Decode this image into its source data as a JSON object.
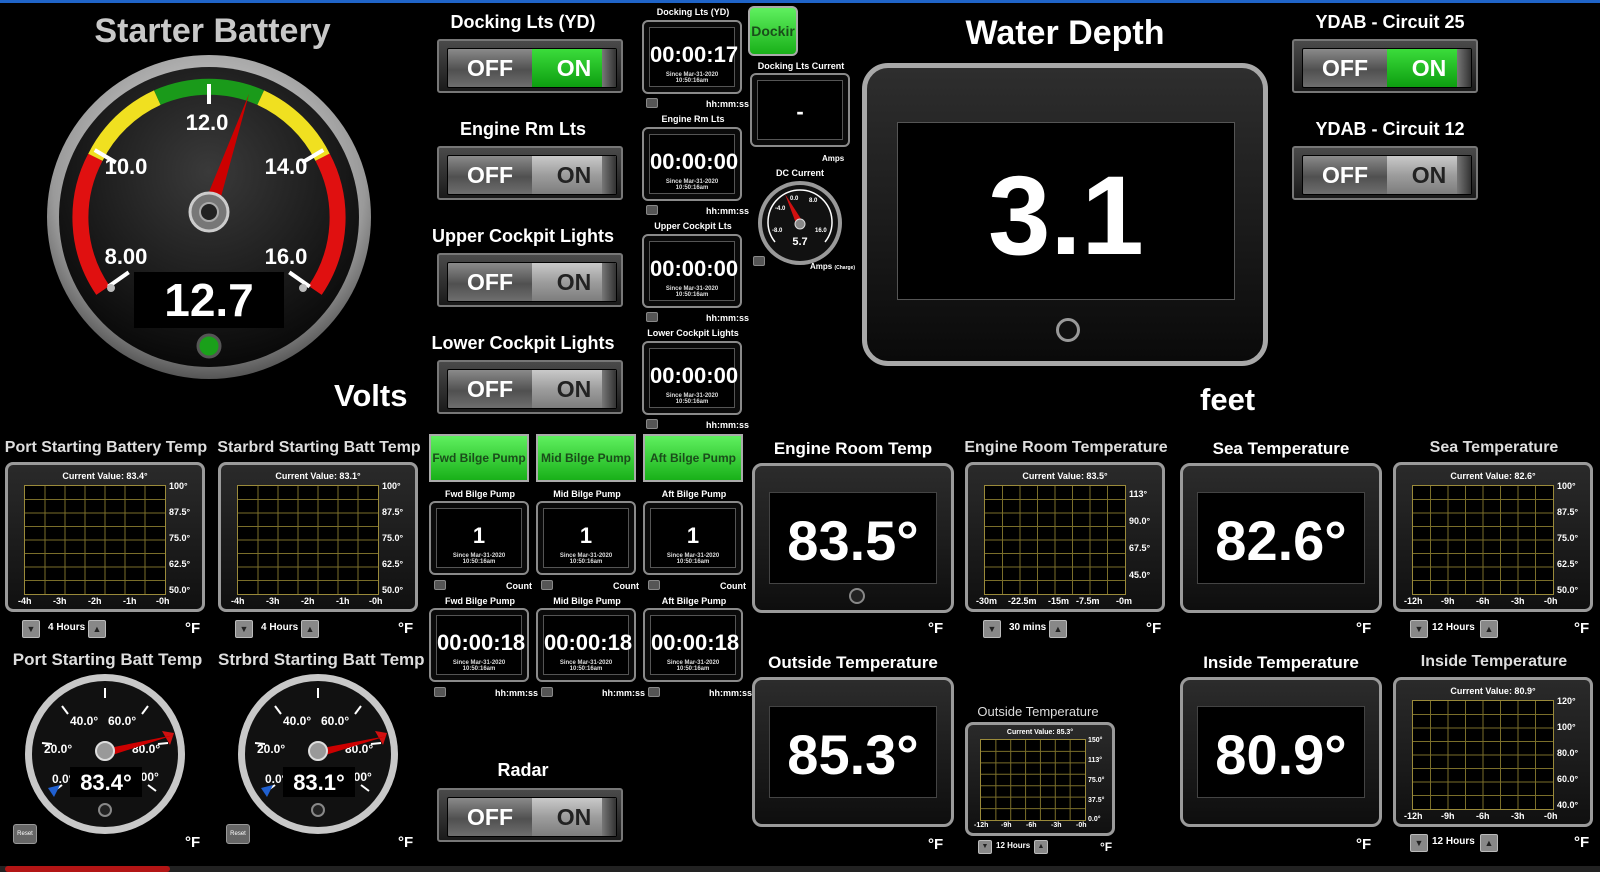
{
  "starter_battery": {
    "title": "Starter Battery",
    "value": "12.7",
    "unit": "Volts",
    "ticks": [
      "8.00",
      "10.0",
      "12.0",
      "14.0",
      "16.0"
    ]
  },
  "switches": [
    {
      "title": "Docking Lts (YD)",
      "off": "OFF",
      "on": "ON",
      "state": "on"
    },
    {
      "title": "Engine Rm Lts",
      "off": "OFF",
      "on": "ON",
      "state": "off"
    },
    {
      "title": "Upper Cockpit Lights",
      "off": "OFF",
      "on": "ON",
      "state": "off"
    },
    {
      "title": "Lower Cockpit Lights",
      "off": "OFF",
      "on": "ON",
      "state": "off"
    },
    {
      "title": "Radar",
      "off": "OFF",
      "on": "ON",
      "state": "off"
    },
    {
      "title": "YDAB - Circuit 25",
      "off": "OFF",
      "on": "ON",
      "state": "on"
    },
    {
      "title": "YDAB - Circuit 12",
      "off": "OFF",
      "on": "ON",
      "state": "off"
    }
  ],
  "timers": [
    {
      "label": "Docking Lts (YD)",
      "value": "00:00:17",
      "since": "Since Mar-31-2020 10:50:16am",
      "unit": "hh:mm:ss"
    },
    {
      "label": "Engine Rm Lts",
      "value": "00:00:00",
      "since": "Since Mar-31-2020 10:50:16am",
      "unit": "hh:mm:ss"
    },
    {
      "label": "Upper Cockpit Lts",
      "value": "00:00:00",
      "since": "Since Mar-31-2020 10:50:16am",
      "unit": "hh:mm:ss"
    },
    {
      "label": "Lower Cockpit Lights",
      "value": "00:00:00",
      "since": "Since Mar-31-2020 10:50:16am",
      "unit": "hh:mm:ss"
    }
  ],
  "docking_button": "Dockir",
  "docking_current": {
    "label": "Docking Lts Current",
    "value": "-",
    "unit": "Amps"
  },
  "dc_current": {
    "label": "DC Current",
    "value": "5.7",
    "unit": "Amps",
    "sub": "(Charge)",
    "ticks": [
      "-8.0",
      "-4.0",
      "0.0",
      "8.0",
      "16.0"
    ]
  },
  "water_depth": {
    "title": "Water Depth",
    "value": "3.1",
    "unit": "feet"
  },
  "bilge": {
    "buttons": [
      "Fwd Bilge Pump",
      "Mid Bilge Pump",
      "Aft Bilge Pump"
    ],
    "counts": [
      {
        "label": "Fwd Bilge Pump",
        "value": "1",
        "since": "Since Mar-31-2020 10:50:16am",
        "unit": "Count"
      },
      {
        "label": "Mid Bilge Pump",
        "value": "1",
        "since": "Since Mar-31-2020 10:50:16am",
        "unit": "Count"
      },
      {
        "label": "Aft Bilge Pump",
        "value": "1",
        "since": "Since Mar-31-2020 10:50:16am",
        "unit": "Count"
      }
    ],
    "runtimes": [
      {
        "label": "Fwd Bilge Pump",
        "value": "00:00:18",
        "since": "Since Mar-31-2020 10:50:16am",
        "unit": "hh:mm:ss"
      },
      {
        "label": "Mid Bilge Pump",
        "value": "00:00:18",
        "since": "Since Mar-31-2020 10:50:16am",
        "unit": "hh:mm:ss"
      },
      {
        "label": "Aft Bilge Pump",
        "value": "00:00:18",
        "since": "Since Mar-31-2020 10:50:16am",
        "unit": "hh:mm:ss"
      }
    ]
  },
  "value_boxes": [
    {
      "title": "Engine Room Temp",
      "value": "83.5°",
      "unit": "°F"
    },
    {
      "title": "Sea Temperature",
      "value": "82.6°",
      "unit": "°F"
    },
    {
      "title": "Outside Temperature",
      "value": "85.3°",
      "unit": "°F"
    },
    {
      "title": "Inside Temperature",
      "value": "80.9°",
      "unit": "°F"
    }
  ],
  "charts": [
    {
      "title": "Port Starting Battery Temp",
      "current": "Current Value: 83.4°",
      "yticks": [
        "100°",
        "87.5°",
        "75.0°",
        "62.5°",
        "50.0°"
      ],
      "xticks": [
        "-4h",
        "-3h",
        "-2h",
        "-1h",
        "-0h"
      ],
      "range": "4 Hours",
      "unit": "°F"
    },
    {
      "title": "Starbrd Starting Batt Temp",
      "current": "Current Value: 83.1°",
      "yticks": [
        "100°",
        "87.5°",
        "75.0°",
        "62.5°",
        "50.0°"
      ],
      "xticks": [
        "-4h",
        "-3h",
        "-2h",
        "-1h",
        "-0h"
      ],
      "range": "4 Hours",
      "unit": "°F"
    },
    {
      "title": "Engine Room Temperature",
      "current": "Current Value: 83.5°",
      "yticks": [
        "113°",
        "90.0°",
        "67.5°",
        "45.0°"
      ],
      "xticks": [
        "-30m",
        "-22.5m",
        "-15m",
        "-7.5m",
        "-0m"
      ],
      "range": "30 mins",
      "unit": "°F"
    },
    {
      "title": "Sea Temperature",
      "current": "Current Value: 82.6°",
      "yticks": [
        "100°",
        "87.5°",
        "75.0°",
        "62.5°",
        "50.0°"
      ],
      "xticks": [
        "-12h",
        "-9h",
        "-6h",
        "-3h",
        "-0h"
      ],
      "range": "12 Hours",
      "unit": "°F"
    },
    {
      "title": "Outside Temperature",
      "current": "Current Value: 85.3°",
      "yticks": [
        "150°",
        "113°",
        "75.0°",
        "37.5°",
        "0.0°"
      ],
      "xticks": [
        "-12h",
        "-9h",
        "-6h",
        "-3h",
        "-0h"
      ],
      "range": "12 Hours",
      "unit": "°F"
    },
    {
      "title": "Inside Temperature",
      "current": "Current Value: 80.9°",
      "yticks": [
        "120°",
        "100°",
        "80.0°",
        "60.0°",
        "40.0°"
      ],
      "xticks": [
        "-12h",
        "-9h",
        "-6h",
        "-3h",
        "-0h"
      ],
      "range": "12 Hours",
      "unit": "°F"
    }
  ],
  "batt_temp_gauges": [
    {
      "title": "Port Starting Batt Temp",
      "value": "83.4°",
      "unit": "°F",
      "reset": "Reset",
      "ticks": [
        "0.0°",
        "20.0°",
        "40.0°",
        "60.0°",
        "80.0°",
        "100°"
      ]
    },
    {
      "title": "Strbrd Starting Batt Temp",
      "value": "83.1°",
      "unit": "°F",
      "reset": "Reset",
      "ticks": [
        "0.0°",
        "20.0°",
        "40.0°",
        "60.0°",
        "80.0°",
        "100°"
      ]
    }
  ],
  "colors": {
    "on_green": "#1db31d",
    "gauge_green": "#1a9a1a",
    "gauge_yellow": "#f0e020",
    "gauge_red": "#e01010",
    "needle": "#d01010"
  }
}
